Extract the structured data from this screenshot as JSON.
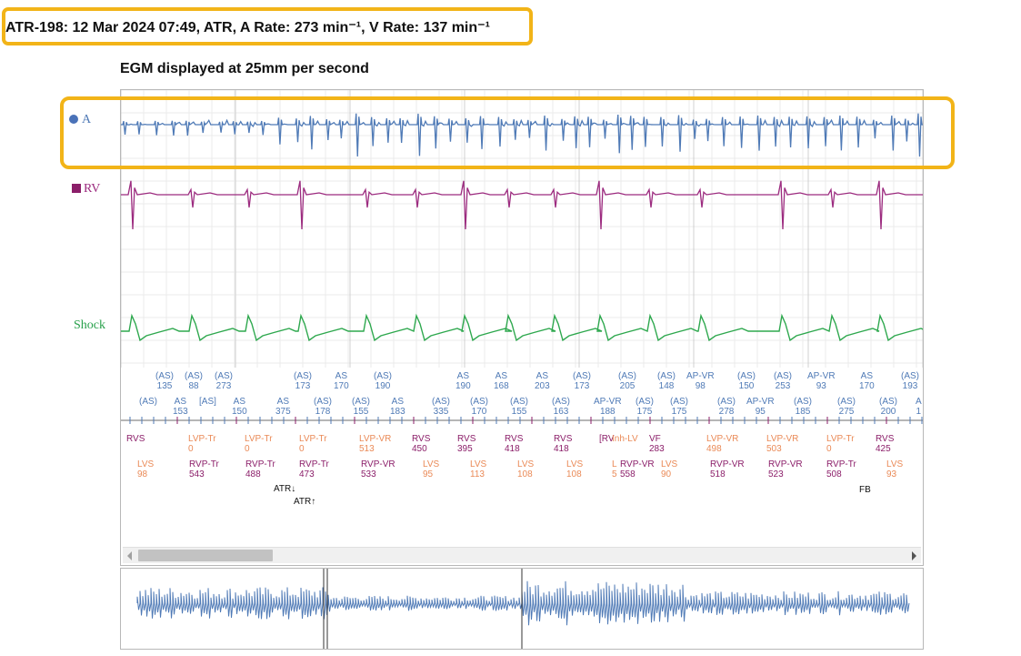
{
  "header": {
    "title": "ATR-198: 12 Mar 2024 07:49, ATR, A Rate: 273 min⁻¹, V Rate: 137 min⁻¹"
  },
  "subtitle": "EGM displayed at 25mm per second",
  "channels": {
    "a": "A",
    "rv": "RV",
    "shock": "Shock"
  },
  "colors": {
    "a_trace": "#4f7ab6",
    "rv_trace": "#9c2b7f",
    "shock_trace": "#2ea84e",
    "highlight": "#f2b418",
    "sensed_marker": "#8b1e69",
    "lv_marker": "#ea8a57"
  },
  "atrial_markers": {
    "row1": [
      {
        "l1": "(AS)",
        "l2": "135"
      },
      {
        "l1": "(AS)",
        "l2": "88"
      },
      {
        "l1": "(AS)",
        "l2": "273"
      },
      {
        "l1": "(AS)",
        "l2": "173"
      },
      {
        "l1": "AS",
        "l2": "170"
      },
      {
        "l1": "(AS)",
        "l2": "190"
      },
      {
        "l1": "AS",
        "l2": "190"
      },
      {
        "l1": "AS",
        "l2": "168"
      },
      {
        "l1": "AS",
        "l2": "203"
      },
      {
        "l1": "(AS)",
        "l2": "173"
      },
      {
        "l1": "(AS)",
        "l2": "205"
      },
      {
        "l1": "(AS)",
        "l2": "148"
      },
      {
        "l1": "AP-VR",
        "l2": "98"
      },
      {
        "l1": "(AS)",
        "l2": "150"
      },
      {
        "l1": "(AS)",
        "l2": "253"
      },
      {
        "l1": "AP-VR",
        "l2": "93"
      },
      {
        "l1": "AS",
        "l2": "170"
      },
      {
        "l1": "(AS)",
        "l2": "193"
      }
    ],
    "row2": [
      {
        "l1": "(AS)",
        "l2": ""
      },
      {
        "l1": "AS",
        "l2": "153"
      },
      {
        "l1": "[AS]",
        "l2": ""
      },
      {
        "l1": "AS",
        "l2": "150"
      },
      {
        "l1": "AS",
        "l2": "375"
      },
      {
        "l1": "(AS)",
        "l2": "178"
      },
      {
        "l1": "(AS)",
        "l2": "155"
      },
      {
        "l1": "AS",
        "l2": "183"
      },
      {
        "l1": "(AS)",
        "l2": "335"
      },
      {
        "l1": "(AS)",
        "l2": "170"
      },
      {
        "l1": "(AS)",
        "l2": "155"
      },
      {
        "l1": "(AS)",
        "l2": "163"
      },
      {
        "l1": "AP-VR",
        "l2": "188"
      },
      {
        "l1": "(AS)",
        "l2": "175"
      },
      {
        "l1": "(AS)",
        "l2": "175"
      },
      {
        "l1": "(AS)",
        "l2": "278"
      },
      {
        "l1": "AP-VR",
        "l2": "95"
      },
      {
        "l1": "(AS)",
        "l2": "185"
      },
      {
        "l1": "(AS)",
        "l2": "275"
      },
      {
        "l1": "(AS)",
        "l2": "200"
      },
      {
        "l1": "A",
        "l2": "1"
      }
    ]
  },
  "ventricular_markers": {
    "row1": [
      {
        "l1": "RVS",
        "l2": ""
      },
      {
        "l1": "LVP-Tr",
        "l2": "0"
      },
      {
        "l1": "LVP-Tr",
        "l2": "0"
      },
      {
        "l1": "LVP-Tr",
        "l2": "0"
      },
      {
        "l1": "LVP-VR",
        "l2": "513"
      },
      {
        "l1": "RVS",
        "l2": "450"
      },
      {
        "l1": "RVS",
        "l2": "395"
      },
      {
        "l1": "RVS",
        "l2": "418"
      },
      {
        "l1": "RVS",
        "l2": "418"
      },
      {
        "l1": "[RV",
        "l2": ""
      },
      {
        "l1": "Inh-LV",
        "l2": ""
      },
      {
        "l1": "VF",
        "l2": "283"
      },
      {
        "l1": "LVP-VR",
        "l2": "498"
      },
      {
        "l1": "LVP-VR",
        "l2": "503"
      },
      {
        "l1": "LVP-Tr",
        "l2": "0"
      },
      {
        "l1": "RVS",
        "l2": "425"
      }
    ],
    "row2": [
      {
        "l1": "LVS",
        "l2": "98"
      },
      {
        "l1": "RVP-Tr",
        "l2": "543"
      },
      {
        "l1": "RVP-Tr",
        "l2": "488"
      },
      {
        "l1": "RVP-Tr",
        "l2": "473"
      },
      {
        "l1": "RVP-VR",
        "l2": "533"
      },
      {
        "l1": "LVS",
        "l2": "95"
      },
      {
        "l1": "LVS",
        "l2": "113"
      },
      {
        "l1": "LVS",
        "l2": "108"
      },
      {
        "l1": "LVS",
        "l2": "108"
      },
      {
        "l1": "L",
        "l2": "5"
      },
      {
        "l1": "RVP-VR",
        "l2": "558"
      },
      {
        "l1": "LVS",
        "l2": "90"
      },
      {
        "l1": "RVP-VR",
        "l2": "518"
      },
      {
        "l1": "RVP-VR",
        "l2": "523"
      },
      {
        "l1": "RVP-Tr",
        "l2": "508"
      },
      {
        "l1": "LVS",
        "l2": "93"
      }
    ]
  },
  "event_markers": [
    "ATR↓",
    "ATR↑",
    "FB"
  ],
  "scrollbar": {
    "position_fraction": 0.0
  }
}
